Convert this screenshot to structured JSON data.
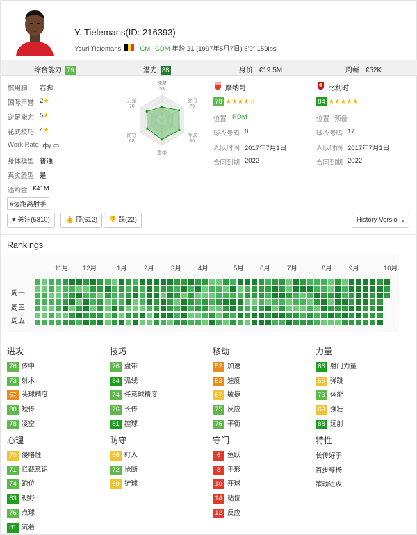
{
  "player": {
    "name": "Y. Tielemans(ID: 216393)",
    "full_name": "Youri Tielemans",
    "positions": [
      "CM",
      "CDM"
    ],
    "details": "年龄 21 (1997年5月7日) 5'9\" 159lbs"
  },
  "summary": [
    {
      "label": "综合能力",
      "value": "79",
      "color": "#5fb94a"
    },
    {
      "label": "潜力",
      "value": "88",
      "color": "#1e9e1e"
    },
    {
      "label": "身价",
      "value": "€19.5M"
    },
    {
      "label": "周薪",
      "value": "€52K"
    }
  ],
  "info": [
    {
      "label": "惯用脚",
      "value": "右脚"
    },
    {
      "label": "国际声誉",
      "value": "2",
      "star": "★"
    },
    {
      "label": "逆足能力",
      "value": "5",
      "star": "★"
    },
    {
      "label": "花式技巧",
      "value": "4",
      "star": "★"
    },
    {
      "label": "Work Rate",
      "value": "中/ 中"
    },
    {
      "label": "身体模型",
      "value": "普通"
    },
    {
      "label": "真实脸型",
      "value": "是"
    },
    {
      "label": "违约金",
      "value": "€41M"
    }
  ],
  "tag": "#远距离射手",
  "buttons": {
    "follow": "关注(5810)",
    "up": "顶(612)",
    "down": "踩(22)",
    "history": "History Versio"
  },
  "radar": {
    "labels": [
      "速度",
      "射门",
      "传球",
      "盘带",
      "防守",
      "力量"
    ],
    "values": [
      53,
      79,
      80,
      77,
      68,
      70
    ]
  },
  "club": {
    "name": "摩纳哥",
    "rating": "78",
    "stars": "★★★★☆",
    "rows": [
      {
        "label": "位置",
        "value": "RDM"
      },
      {
        "label": "球衣号码",
        "value": "8"
      },
      {
        "label": "入队时间",
        "value": "2017年7月1日"
      },
      {
        "label": "合同到期",
        "value": "2022"
      }
    ]
  },
  "national": {
    "name": "比利时",
    "rating": "84",
    "stars": "★★★★★",
    "rows": [
      {
        "label": "位置",
        "value": "预备"
      },
      {
        "label": "球衣号码",
        "value": "17"
      },
      {
        "label": "入队时间",
        "value": "2017年7月1日"
      },
      {
        "label": "合同到期",
        "value": "2022"
      }
    ]
  },
  "rankings": {
    "title": "Rankings",
    "months": [
      "11月",
      "12月",
      "1月",
      "2月",
      "3月",
      "4月",
      "5月",
      "6月",
      "7月",
      "8月",
      "9月",
      "10月"
    ],
    "days": [
      "周一",
      "周三",
      "周五"
    ]
  },
  "stats": [
    {
      "category": "进攻",
      "items": [
        {
          "value": "76",
          "label": "传中",
          "color": "#5fb94a"
        },
        {
          "value": "73",
          "label": "射术",
          "color": "#5fb94a"
        },
        {
          "value": "57",
          "label": "头球精度",
          "color": "#e88c1e"
        },
        {
          "value": "80",
          "label": "短传",
          "color": "#5fb94a"
        },
        {
          "value": "78",
          "label": "凌空",
          "color": "#5fb94a"
        }
      ]
    },
    {
      "category": "技巧",
      "items": [
        {
          "value": "76",
          "label": "盘带",
          "color": "#5fb94a"
        },
        {
          "value": "84",
          "label": "弧线",
          "color": "#1e9e1e"
        },
        {
          "value": "74",
          "label": "任意球精度",
          "color": "#5fb94a"
        },
        {
          "value": "76",
          "label": "长传",
          "color": "#5fb94a"
        },
        {
          "value": "81",
          "label": "控球",
          "color": "#1e9e1e"
        }
      ]
    },
    {
      "category": "移动",
      "items": [
        {
          "value": "52",
          "label": "加速",
          "color": "#e88c1e"
        },
        {
          "value": "53",
          "label": "速度",
          "color": "#e88c1e"
        },
        {
          "value": "67",
          "label": "敏捷",
          "color": "#f1c232"
        },
        {
          "value": "75",
          "label": "反应",
          "color": "#5fb94a"
        },
        {
          "value": "76",
          "label": "平衡",
          "color": "#5fb94a"
        }
      ]
    },
    {
      "category": "力量",
      "items": [
        {
          "value": "88",
          "label": "射门力量",
          "color": "#1e9e1e"
        },
        {
          "value": "65",
          "label": "弹跳",
          "color": "#f1c232"
        },
        {
          "value": "73",
          "label": "体能",
          "color": "#5fb94a"
        },
        {
          "value": "69",
          "label": "强壮",
          "color": "#f1c232"
        },
        {
          "value": "88",
          "label": "远射",
          "color": "#1e9e1e"
        }
      ]
    },
    {
      "category": "心理",
      "items": [
        {
          "value": "70",
          "label": "侵略性",
          "color": "#f1c232"
        },
        {
          "value": "71",
          "label": "拦截意识",
          "color": "#5fb94a"
        },
        {
          "value": "74",
          "label": "跑位",
          "color": "#5fb94a"
        },
        {
          "value": "83",
          "label": "视野",
          "color": "#1e9e1e"
        },
        {
          "value": "76",
          "label": "点球",
          "color": "#5fb94a"
        },
        {
          "value": "81",
          "label": "沉着",
          "color": "#1e9e1e"
        }
      ]
    },
    {
      "category": "防守",
      "items": [
        {
          "value": "66",
          "label": "盯人",
          "color": "#f1c232"
        },
        {
          "value": "72",
          "label": "抢断",
          "color": "#5fb94a"
        },
        {
          "value": "69",
          "label": "铲球",
          "color": "#f1c232"
        }
      ]
    },
    {
      "category": "守门",
      "items": [
        {
          "value": "6",
          "label": "鱼跃",
          "color": "#e23b2b"
        },
        {
          "value": "8",
          "label": "手形",
          "color": "#e23b2b"
        },
        {
          "value": "10",
          "label": "开球",
          "color": "#e23b2b"
        },
        {
          "value": "14",
          "label": "站位",
          "color": "#e23b2b"
        },
        {
          "value": "12",
          "label": "反应",
          "color": "#e23b2b"
        }
      ]
    }
  ],
  "traits": {
    "category": "特性",
    "items": [
      "长传好手",
      "百步穿杨",
      "策动进攻"
    ]
  },
  "colors": {
    "badge_green": "#1e9e1e",
    "badge_light_green": "#5fb94a",
    "badge_orange": "#e88c1e",
    "badge_yellow": "#f1c232",
    "badge_red": "#e23b2b"
  }
}
